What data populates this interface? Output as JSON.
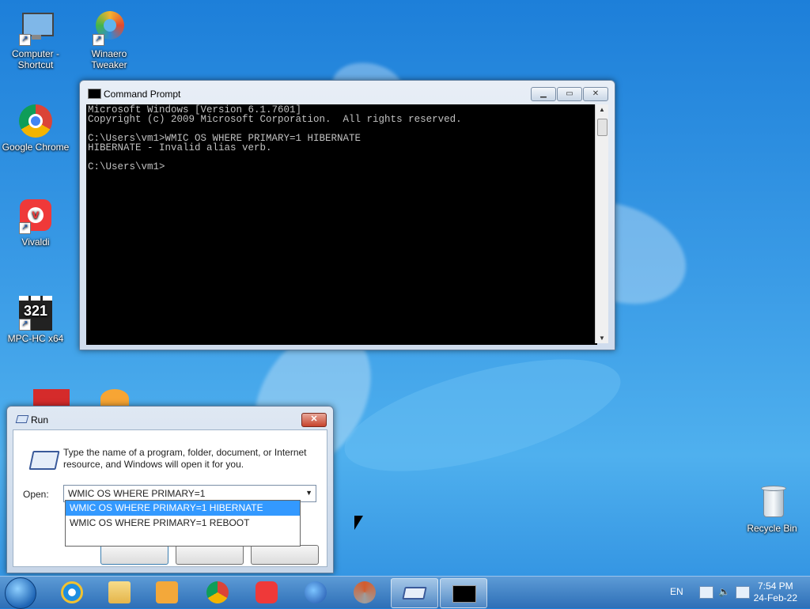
{
  "desktop": {
    "icons": [
      {
        "label": "Computer -\nShortcut",
        "icon": "computer-icon"
      },
      {
        "label": "Winaero\nTweaker",
        "icon": "winaero-tweaker-icon"
      },
      {
        "label": "Google Chrome",
        "icon": "chrome-icon"
      },
      {
        "label": "Vivaldi",
        "icon": "vivaldi-icon"
      },
      {
        "label": "MPC-HC x64",
        "icon": "mpc-hc-icon"
      },
      {
        "label": "Recycle Bin",
        "icon": "recycle-bin-icon"
      }
    ]
  },
  "cmd": {
    "title": "Command Prompt",
    "lines": [
      "Microsoft Windows [Version 6.1.7601]",
      "Copyright (c) 2009 Microsoft Corporation.  All rights reserved.",
      "",
      "C:\\Users\\vm1>WMIC OS WHERE PRIMARY=1 HIBERNATE",
      "HIBERNATE - Invalid alias verb.",
      "",
      "C:\\Users\\vm1>"
    ]
  },
  "run": {
    "title": "Run",
    "description": "Type the name of a program, folder, document, or Internet resource, and Windows will open it for you.",
    "open_label": "Open:",
    "input_value": "WMIC OS WHERE PRIMARY=1",
    "suggestions": [
      "WMIC OS WHERE PRIMARY=1 HIBERNATE",
      "WMIC OS WHERE PRIMARY=1 REBOOT"
    ]
  },
  "taskbar": {
    "apps": [
      "internet-explorer-icon",
      "file-explorer-icon",
      "media-player-icon",
      "chrome-icon",
      "vivaldi-icon",
      "thunderbird-icon",
      "winaero-tweaker-icon",
      "run-icon",
      "cmd-icon"
    ],
    "language": "EN",
    "time": "7:54 PM",
    "date": "24-Feb-22"
  }
}
